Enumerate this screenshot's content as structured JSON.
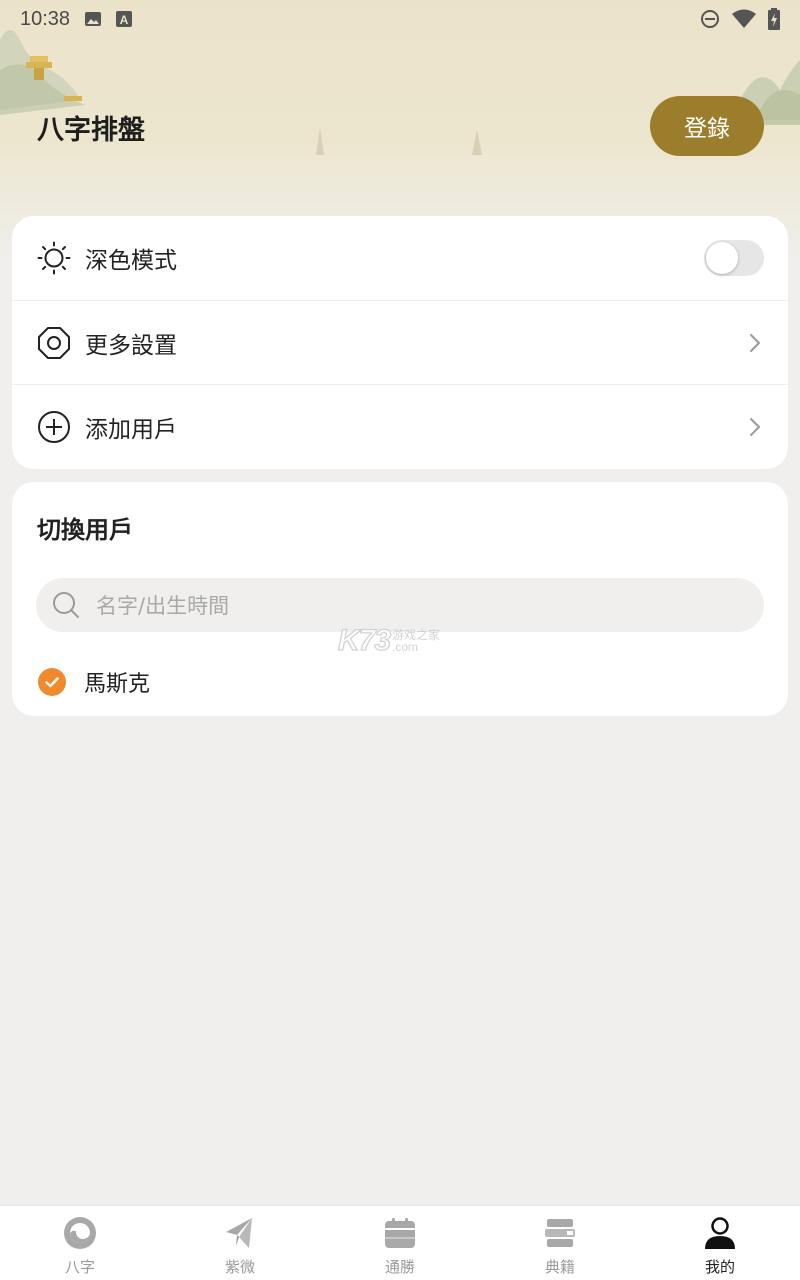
{
  "status_bar": {
    "time": "10:38",
    "icons": [
      "image-notification-icon",
      "text-notification-icon",
      "do-not-disturb-icon",
      "wifi-icon",
      "battery-charging-icon"
    ]
  },
  "header": {
    "title": "八字排盤",
    "login_label": "登錄"
  },
  "settings": {
    "dark_mode": {
      "label": "深色模式",
      "icon": "sun-icon",
      "enabled": false
    },
    "more_settings": {
      "label": "更多設置",
      "icon": "settings-octagon-icon"
    },
    "add_user": {
      "label": "添加用戶",
      "icon": "add-circle-icon"
    }
  },
  "switch_user": {
    "title": "切換用戶",
    "search_placeholder": "名字/出生時間",
    "users": [
      {
        "name": "馬斯克",
        "selected": true
      }
    ]
  },
  "watermark": {
    "logo": "K73",
    "text_cn": "游戏之家",
    "text_com": ".com"
  },
  "bottom_nav": {
    "items": [
      {
        "label": "八字",
        "icon": "bazi-icon",
        "active": false
      },
      {
        "label": "紫微",
        "icon": "paper-plane-icon",
        "active": false
      },
      {
        "label": "通勝",
        "icon": "calendar-icon",
        "active": false
      },
      {
        "label": "典籍",
        "icon": "books-icon",
        "active": false
      },
      {
        "label": "我的",
        "icon": "person-icon",
        "active": true
      }
    ]
  },
  "colors": {
    "accent_gold": "#9c7d2c",
    "check_orange": "#f08a2c",
    "header_bg": "#ebe3c9",
    "page_bg": "#f0efed"
  }
}
